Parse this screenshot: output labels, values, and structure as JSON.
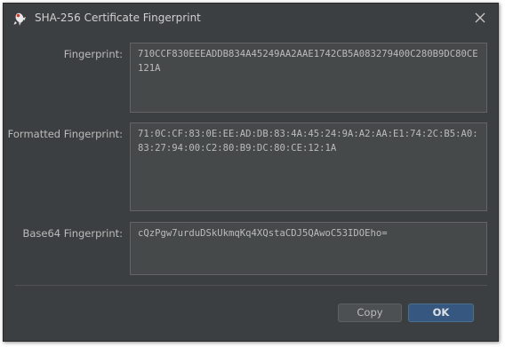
{
  "window": {
    "title": "SHA-256 Certificate Fingerprint",
    "app_icon": "duke-mascot-icon",
    "close_icon": "close-icon"
  },
  "fields": [
    {
      "label": "Fingerprint:",
      "value": "710CCF830EEEADDB834A45249AA2AAE1742CB5A083279400C280B9DC80CE121A"
    },
    {
      "label": "Formatted Fingerprint:",
      "value": "71:0C:CF:83:0E:EE:AD:DB:83:4A:45:24:9A:A2:AA:E1:74:2C:B5:A0:83:27:94:00:C2:80:B9:DC:80:CE:12:1A"
    },
    {
      "label": "Base64 Fingerprint:",
      "value": "cQzPgw7urduDSkUkmqKq4XQstaCDJ5QAwoC53IDOEho="
    }
  ],
  "buttons": {
    "copy_label": "Copy",
    "ok_label": "OK"
  },
  "colors": {
    "background": "#3c3f41",
    "field_background": "#45494a",
    "ok_button": "#365880",
    "text": "#bbbbbb"
  }
}
